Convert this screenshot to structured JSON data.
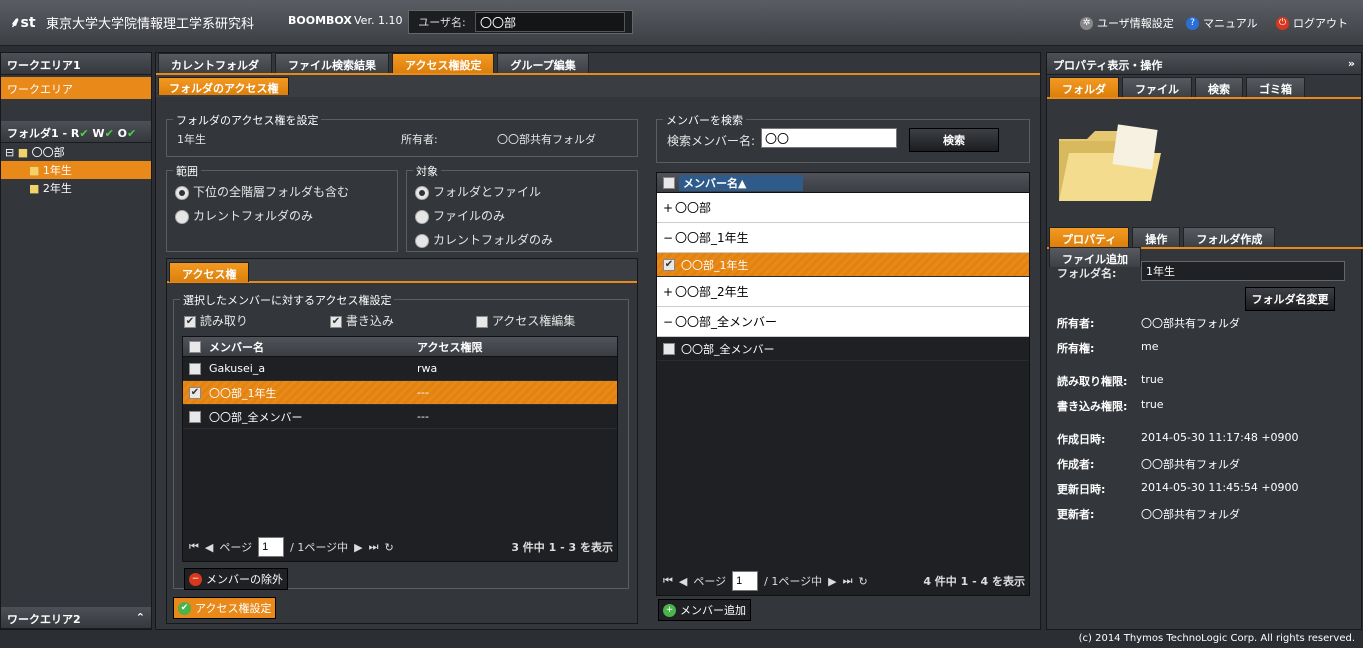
{
  "header": {
    "logo": "st",
    "org_name": "東京大学大学院情報理工学系研究科",
    "app_name": "BOOMBOX",
    "version": "Ver. 1.10",
    "user_label": "ユーザ名:",
    "user_value": "〇〇部",
    "user_settings": "ユーザ情報設定",
    "manual": "マニュアル",
    "logout": "ログアウト"
  },
  "left": {
    "work1_title": "ワークエリア1",
    "work_area_item": "ワークエリア",
    "folder_title": "フォルダ1 - R",
    "folder_flags": [
      "W",
      "O"
    ],
    "tree_root": "〇〇部",
    "tree_children": [
      "1年生",
      "2年生"
    ],
    "work2_title": "ワークエリア2"
  },
  "main_tabs": [
    "カレントフォルダ",
    "ファイル検索結果",
    "アクセス権設定",
    "グループ編集"
  ],
  "sub_tab": "フォルダのアクセス権",
  "access": {
    "set_title": "フォルダのアクセス権を設定",
    "folder": "1年生",
    "owner_label": "所有者:",
    "owner_value": "〇〇部共有フォルダ",
    "scope_title": "範囲",
    "scope_opts": [
      "下位の全階層フォルダも含む",
      "カレントフォルダのみ"
    ],
    "target_title": "対象",
    "target_opts": [
      "フォルダとファイル",
      "ファイルのみ",
      "カレントフォルダのみ"
    ],
    "perm_tab": "アクセス権",
    "member_perm_title": "選択したメンバーに対するアクセス権設定",
    "read": "読み取り",
    "write": "書き込み",
    "edit": "アクセス権編集",
    "col_member": "メンバー名",
    "col_perm": "アクセス権限",
    "rows": [
      {
        "name": "Gakusei_a",
        "perm": "rwa"
      },
      {
        "name": "〇〇部_1年生",
        "perm": "---"
      },
      {
        "name": "〇〇部_全メンバー",
        "perm": "---"
      }
    ],
    "page_label": "ページ",
    "page": "1",
    "page_of": "/ 1ページ中",
    "count": "3 件中 1 - 3 を表示",
    "remove_btn": "メンバーの除外",
    "apply_btn": "アクセス権設定"
  },
  "search": {
    "title": "メンバーを検索",
    "label": "検索メンバー名:",
    "value": "〇〇",
    "btn": "検索",
    "col": "メンバー名▲",
    "groups": [
      {
        "name": "〇〇部",
        "sign": "+",
        "child": ""
      },
      {
        "name": "〇〇部_1年生",
        "sign": "−",
        "child": "〇〇部_1年生"
      },
      {
        "name": "〇〇部_2年生",
        "sign": "+",
        "child": ""
      },
      {
        "name": "〇〇部_全メンバー",
        "sign": "−",
        "child": "〇〇部_全メンバー"
      }
    ],
    "page_label": "ページ",
    "page": "1",
    "page_of": "/ 1ページ中",
    "count": "4 件中 1 - 4 を表示",
    "add_btn": "メンバー追加"
  },
  "right": {
    "title": "プロパティ表示・操作",
    "tabs": [
      "フォルダ",
      "ファイル",
      "検索",
      "ゴミ箱"
    ],
    "tabs2": [
      "プロパティ",
      "操作",
      "フォルダ作成",
      "ファイル追加"
    ],
    "name_label": "フォルダ名:",
    "name_value": "1年生",
    "rename_btn": "フォルダ名変更",
    "props": [
      {
        "k": "所有者:",
        "v": "〇〇部共有フォルダ"
      },
      {
        "k": "所有権:",
        "v": "me"
      },
      {
        "k": "読み取り権限:",
        "v": "true"
      },
      {
        "k": "書き込み権限:",
        "v": "true"
      },
      {
        "k": "作成日時:",
        "v": "2014-05-30 11:17:48 +0900"
      },
      {
        "k": "作成者:",
        "v": "〇〇部共有フォルダ"
      },
      {
        "k": "更新日時:",
        "v": "2014-05-30 11:45:54 +0900"
      },
      {
        "k": "更新者:",
        "v": "〇〇部共有フォルダ"
      }
    ]
  },
  "footer": "(c) 2014 Thymos TechnoLogic Corp. All rights reserved.",
  "colors": {
    "accent": "#e8891a",
    "bg": "#2b2e33"
  }
}
